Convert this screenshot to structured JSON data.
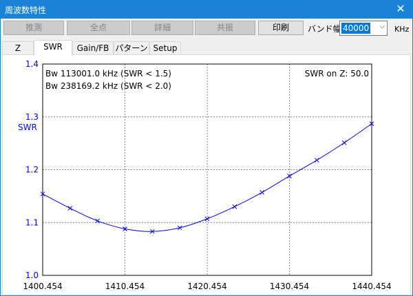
{
  "window": {
    "title": "周波数特性",
    "close_glyph": "✕"
  },
  "toolbar": {
    "buttons": [
      {
        "label": "推測",
        "enabled": false
      },
      {
        "label": "全点",
        "enabled": false
      },
      {
        "label": "詳細",
        "enabled": false
      },
      {
        "label": "共振",
        "enabled": false
      },
      {
        "label": "印刷",
        "enabled": true
      }
    ],
    "band_label": "バンド幅",
    "band_value": "40000",
    "band_unit": "KHz"
  },
  "tabs": [
    {
      "label": "Z",
      "active": false
    },
    {
      "label": "SWR",
      "active": true
    },
    {
      "label": "Gain/FB",
      "active": false
    },
    {
      "label": "パターン",
      "active": false
    },
    {
      "label": "Setup",
      "active": false
    }
  ],
  "colors": {
    "curve": "#0000ff",
    "axis_label": "#0000ff",
    "grid": "#808080",
    "titlebar": "#1883d7"
  },
  "chart_data": {
    "type": "line",
    "ylabel": "SWR",
    "xlabel": "",
    "xlim": [
      1400.454,
      1440.454
    ],
    "ylim": [
      1.0,
      1.4
    ],
    "x_ticks": [
      "1400.454",
      "1410.454",
      "1420.454",
      "1430.454",
      "1440.454"
    ],
    "y_ticks": [
      "1.0",
      "1.1",
      "1.2",
      "1.3",
      "1.4"
    ],
    "grid": true,
    "annotations": [
      "Bw 113001.0 kHz (SWR < 1.5)",
      "Bw 238169.2 kHz (SWR < 2.0)",
      "SWR on Z: 50.0"
    ],
    "series": [
      {
        "marker": "x",
        "x": [
          1400.454,
          1403.787,
          1407.121,
          1410.454,
          1413.787,
          1417.121,
          1420.454,
          1423.787,
          1427.121,
          1430.454,
          1433.787,
          1437.121,
          1440.454
        ],
        "y": [
          1.154,
          1.127,
          1.103,
          1.088,
          1.083,
          1.09,
          1.107,
          1.13,
          1.157,
          1.188,
          1.218,
          1.251,
          1.287
        ]
      }
    ]
  }
}
